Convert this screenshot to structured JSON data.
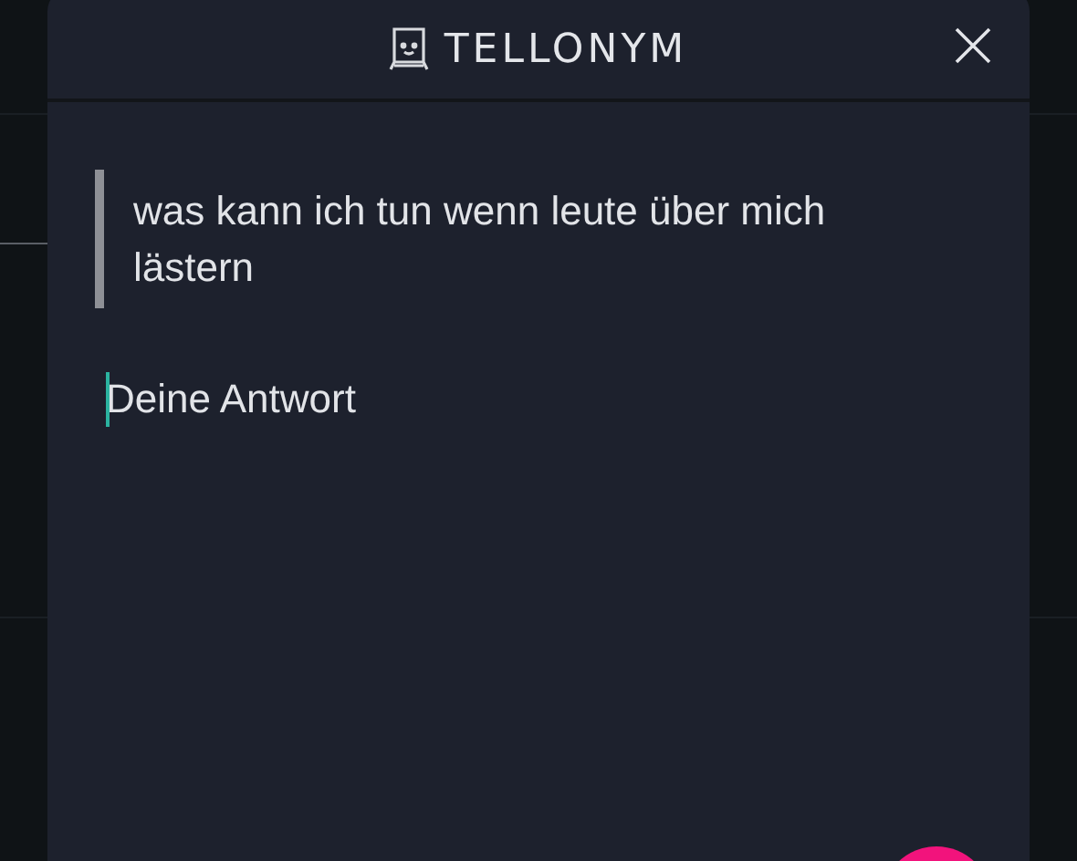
{
  "header": {
    "title": "TELLONYM"
  },
  "question": {
    "text": "was kann ich tun wenn leute über mich lästern"
  },
  "answer": {
    "placeholder": "Deine Antwort"
  }
}
